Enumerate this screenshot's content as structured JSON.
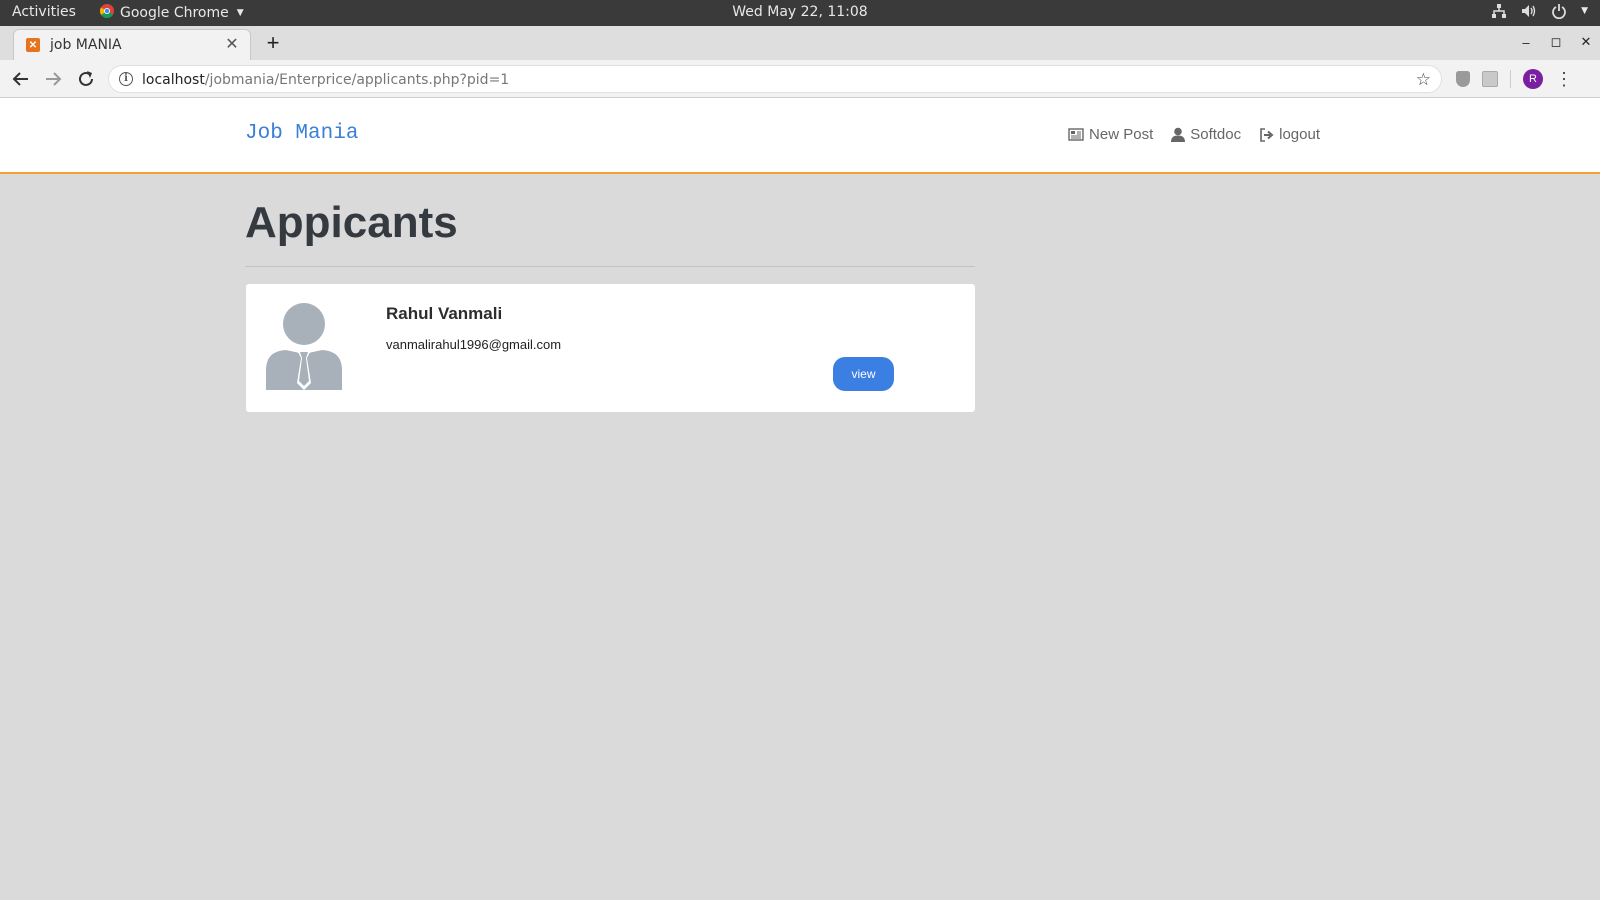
{
  "os": {
    "activities": "Activities",
    "app_name": "Google Chrome",
    "clock": "Wed May 22, 11:08"
  },
  "browser": {
    "tab_title": "job MANIA",
    "url_host": "localhost",
    "url_path": "/jobmania/Enterprice/applicants.php?pid=1",
    "profile_initial": "R"
  },
  "site": {
    "brand": "Job Mania",
    "nav": {
      "new_post": "New Post",
      "user": "Softdoc",
      "logout": "logout"
    }
  },
  "main": {
    "title": "Appicants",
    "applicants": [
      {
        "name": "Rahul Vanmali",
        "email": "vanmalirahul1996@gmail.com",
        "action_label": "view"
      }
    ]
  },
  "colors": {
    "brand": "#3b7fd9",
    "accent_border": "#f0a232",
    "button": "#3b7fe3",
    "avatar_icon": "#a8b0ba"
  }
}
